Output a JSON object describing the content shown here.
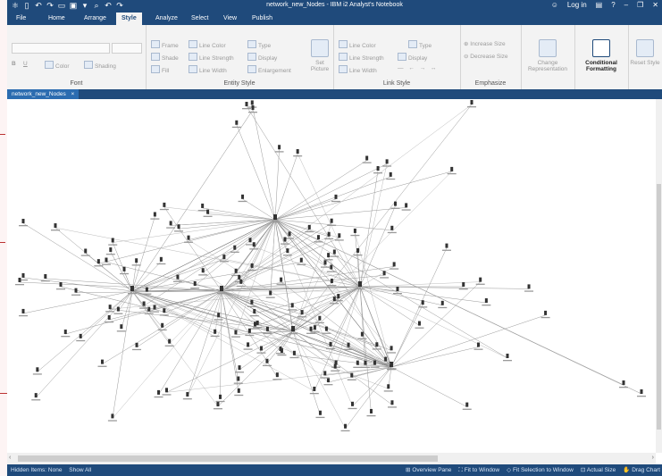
{
  "window": {
    "title": "network_new_Nodes - IBM i2 Analyst's Notebook",
    "login_label": "Log in",
    "help_label": "?"
  },
  "menu_tabs": [
    "File",
    "Home",
    "Arrange",
    "Style",
    "Analyze",
    "Select",
    "View",
    "Publish"
  ],
  "active_tab": "Style",
  "ribbon": {
    "font": {
      "label": "Font",
      "bold": "B",
      "underline": "U",
      "color": "Color",
      "shading": "Shading"
    },
    "entity_style": {
      "label": "Entity Style",
      "frame": "Frame",
      "shade": "Shade",
      "fill": "Fill",
      "line_color": "Line Color",
      "line_strength": "Line Strength",
      "line_width": "Line Width",
      "type": "Type",
      "display": "Display",
      "enlargement": "Enlargement",
      "set_picture": "Set Picture"
    },
    "link_style": {
      "label": "Link Style",
      "line_color": "Line Color",
      "line_strength": "Line Strength",
      "line_width": "Line Width",
      "type": "Type",
      "display": "Display"
    },
    "emphasize": {
      "label": "Emphasize",
      "increase_size": "Increase Size",
      "decrease_size": "Decrease Size"
    },
    "change_representation": "Change Representation",
    "conditional_formatting": "Conditional Formatting",
    "reset_style": "Reset Style"
  },
  "document_tab": {
    "label": "network_new_Nodes",
    "close": "×"
  },
  "status": {
    "hidden_items": "Hidden Items: None",
    "show_all": "Show All",
    "overview_pane": "Overview Pane",
    "fit_to_window": "Fit to Window",
    "fit_selection": "Fit Selection to Window",
    "actual_size": "Actual Size",
    "drag_chart": "Drag Chart"
  },
  "colors": {
    "title_bar": "#1f4a7b",
    "ribbon_bg": "#f3f3f3",
    "doc_tab": "#2b6cb0",
    "edge": "#8a8a8a",
    "node": "#333333"
  },
  "icons": [
    "app-icon",
    "user-icon",
    "minimize-icon",
    "maximize-icon",
    "close-icon"
  ]
}
